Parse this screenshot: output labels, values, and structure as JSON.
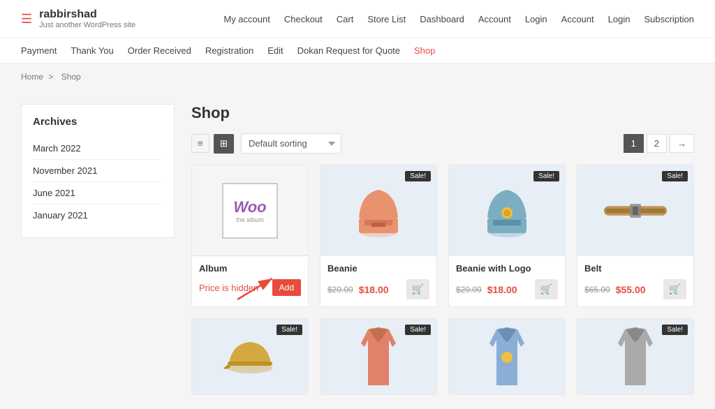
{
  "site": {
    "title": "rabbirshad",
    "tagline": "Just another WordPress site"
  },
  "top_nav": {
    "items": [
      {
        "label": "My account",
        "url": "#"
      },
      {
        "label": "Checkout",
        "url": "#"
      },
      {
        "label": "Cart",
        "url": "#"
      },
      {
        "label": "Store List",
        "url": "#"
      },
      {
        "label": "Dashboard",
        "url": "#"
      },
      {
        "label": "Account",
        "url": "#"
      },
      {
        "label": "Login",
        "url": "#"
      },
      {
        "label": "Account",
        "url": "#"
      },
      {
        "label": "Login",
        "url": "#"
      },
      {
        "label": "Subscription",
        "url": "#"
      }
    ]
  },
  "second_nav": {
    "items": [
      {
        "label": "Payment",
        "url": "#",
        "active": false
      },
      {
        "label": "Thank You",
        "url": "#",
        "active": false
      },
      {
        "label": "Order Received",
        "url": "#",
        "active": false
      },
      {
        "label": "Registration",
        "url": "#",
        "active": false
      },
      {
        "label": "Edit",
        "url": "#",
        "active": false
      },
      {
        "label": "Dokan Request for Quote",
        "url": "#",
        "active": false
      },
      {
        "label": "Shop",
        "url": "#",
        "active": true
      }
    ]
  },
  "breadcrumb": {
    "home": "Home",
    "separator": ">",
    "current": "Shop"
  },
  "sidebar": {
    "title": "Archives",
    "items": [
      {
        "label": "March 2022"
      },
      {
        "label": "November 2021"
      },
      {
        "label": "June 2021"
      },
      {
        "label": "January 2021"
      }
    ]
  },
  "shop": {
    "title": "Shop",
    "sort_placeholder": "Default sorting",
    "view_list_label": "☰",
    "view_grid_label": "⊞",
    "pagination": {
      "pages": [
        "1",
        "2"
      ],
      "next": "→",
      "active": "1"
    }
  },
  "products": [
    {
      "id": 1,
      "name": "Album",
      "type": "woo",
      "sale": false,
      "price_hidden": true,
      "price_hidden_text": "Price is hidden",
      "add_label": "Add"
    },
    {
      "id": 2,
      "name": "Beanie",
      "type": "beanie-pink",
      "sale": true,
      "original_price": "$20.00",
      "sale_price": "$18.00"
    },
    {
      "id": 3,
      "name": "Beanie with Logo",
      "type": "beanie-blue",
      "sale": true,
      "original_price": "$20.00",
      "sale_price": "$18.00"
    },
    {
      "id": 4,
      "name": "Belt",
      "type": "belt",
      "sale": true,
      "original_price": "$65.00",
      "sale_price": "$55.00"
    }
  ],
  "products_row2": [
    {
      "id": 5,
      "name": "",
      "type": "cap",
      "sale": true
    },
    {
      "id": 6,
      "name": "",
      "type": "hoodie-pink",
      "sale": true
    },
    {
      "id": 7,
      "name": "",
      "type": "hoodie-blue",
      "sale": false
    },
    {
      "id": 8,
      "name": "",
      "type": "hoodie-gray",
      "sale": true
    }
  ],
  "icons": {
    "cart": "🛒",
    "menu": "☰",
    "grid": "⊞",
    "list": "≡",
    "chevron": "›"
  },
  "colors": {
    "accent": "#e74c3c",
    "nav_active": "#e74c3c",
    "sale_badge_bg": "#333333",
    "price_hidden": "#e74c3c"
  }
}
